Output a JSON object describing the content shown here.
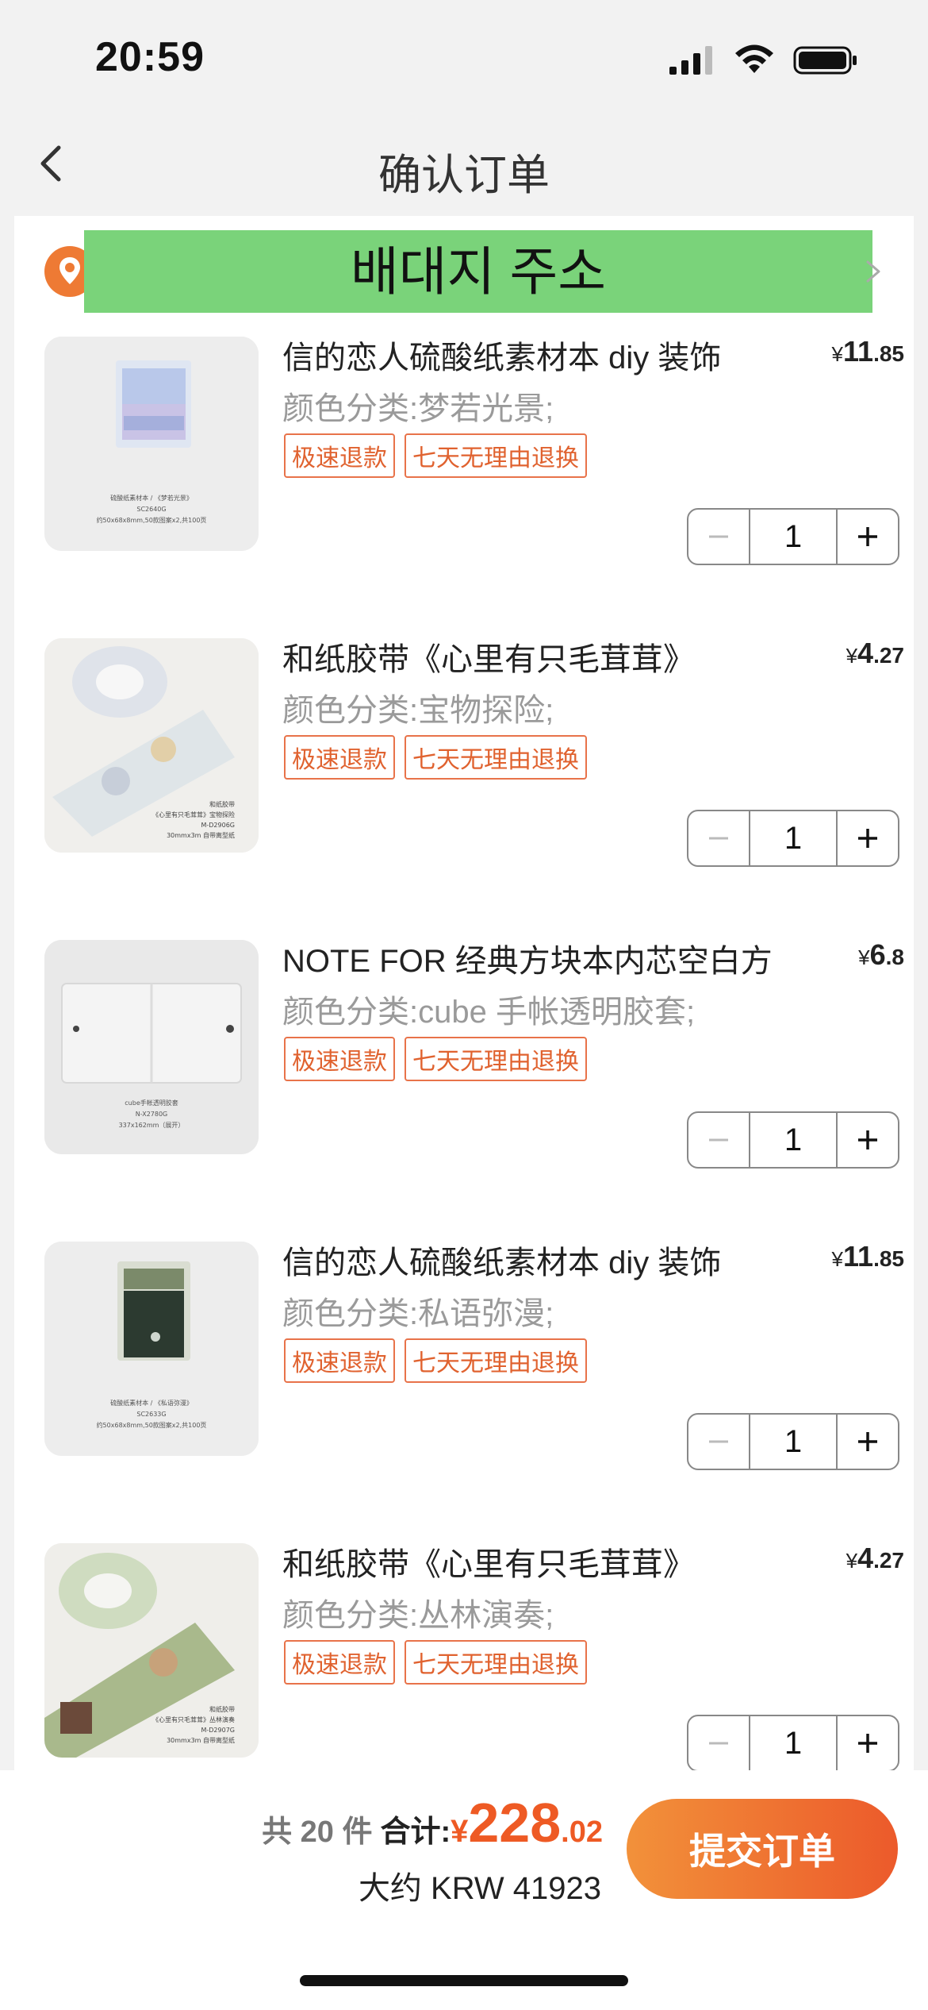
{
  "status_bar": {
    "time": "20:59"
  },
  "nav": {
    "title": "确认订单"
  },
  "address": {
    "label": "배대지 주소"
  },
  "tag_labels": [
    "极速退款",
    "七天无理由退换"
  ],
  "items": [
    {
      "title": "信的恋人硫酸纸素材本 diy 装饰",
      "variant": "颜色分类:梦若光景;",
      "price": {
        "currency": "¥",
        "integer": "11",
        "decimal": ".85"
      },
      "quantity": "1",
      "image_caption": [
        "硫酸纸素材本 / 《梦若光景》",
        "SC2640G",
        "约50x68x8mm,50款图案x2,共100页"
      ]
    },
    {
      "title": "和纸胶带《心里有只毛茸茸》",
      "variant": "颜色分类:宝物探险;",
      "price": {
        "currency": "¥",
        "integer": "4",
        "decimal": ".27"
      },
      "quantity": "1",
      "image_caption": [
        "和纸胶带",
        "《心里有只毛茸茸》宝物探险",
        "M-D2906G",
        "30mmx3m 自带离型纸"
      ]
    },
    {
      "title": "NOTE FOR 经典方块本内芯空白方",
      "variant": "颜色分类:cube 手帐透明胶套;",
      "price": {
        "currency": "¥",
        "integer": "6",
        "decimal": ".8"
      },
      "quantity": "1",
      "image_caption": [
        "cube手帐透明胶套",
        "N-X2780G",
        "337x162mm（展开）"
      ]
    },
    {
      "title": "信的恋人硫酸纸素材本 diy 装饰",
      "variant": "颜色分类:私语弥漫;",
      "price": {
        "currency": "¥",
        "integer": "11",
        "decimal": ".85"
      },
      "quantity": "1",
      "image_caption": [
        "硫酸纸素材本 / 《私语弥漫》",
        "SC2633G",
        "约50x68x8mm,50款图案x2,共100页"
      ]
    },
    {
      "title": "和纸胶带《心里有只毛茸茸》",
      "variant": "颜色分类:丛林演奏;",
      "price": {
        "currency": "¥",
        "integer": "4",
        "decimal": ".27"
      },
      "quantity": "1",
      "image_caption": [
        "和纸胶带",
        "《心里有只毛茸茸》丛林演奏",
        "M-D2907G",
        "30mmx3m 自带离型纸"
      ]
    }
  ],
  "footer": {
    "count_text": "共 20 件",
    "total_label": "合计:",
    "total_currency": "¥",
    "total_integer": "228",
    "total_decimal": ".02",
    "krw": "大约 KRW 41923",
    "submit_label": "提交订单"
  },
  "colors": {
    "accent": "#ec5a2b",
    "tag_border": "#e8734a",
    "address_highlight": "#7ad37a"
  }
}
